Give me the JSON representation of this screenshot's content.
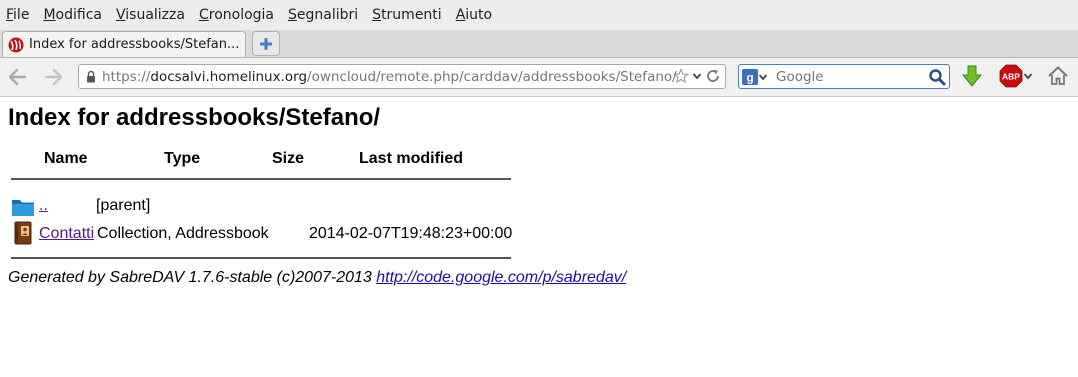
{
  "menubar": {
    "items": [
      {
        "accel": "F",
        "rest": "ile"
      },
      {
        "accel": "M",
        "rest": "odifica"
      },
      {
        "accel": "V",
        "rest": "isualizza"
      },
      {
        "accel": "C",
        "rest": "ronologia"
      },
      {
        "accel": "S",
        "rest": "egnalibri"
      },
      {
        "accel": "S",
        "rest": "trumenti"
      },
      {
        "accel": "A",
        "rest": "iuto"
      }
    ]
  },
  "tab": {
    "title": "Index for addressbooks/Stefan...",
    "favicon": "owncloud-favicon-icon"
  },
  "navbar": {
    "url_scheme": "https://",
    "url_host": "docsalvi.homelinux.org",
    "url_path": "/owncloud/remote.php/carddav/addressbooks/Stefano/",
    "search_placeholder": "Google",
    "search_engine": "google-icon",
    "icons": [
      "back-icon",
      "forward-icon",
      "lock-icon",
      "bookmark-star-icon",
      "dropdown-icon",
      "reload-icon",
      "search-icon",
      "download-arrow-icon",
      "adblock-plus-icon",
      "home-icon"
    ],
    "abp_label": "ABP"
  },
  "page": {
    "title": "Index for addressbooks/Stefano/",
    "columns": {
      "name": "Name",
      "type": "Type",
      "size": "Size",
      "last_modified": "Last modified"
    },
    "rows": [
      {
        "name": "..",
        "type": "[parent]",
        "size": "",
        "last_modified": "",
        "icon": "folder-icon"
      },
      {
        "name": "Contatti",
        "type": "Collection, Addressbook",
        "size": "",
        "last_modified": "2014-02-07T19:48:23+00:00",
        "icon": "addressbook-icon"
      }
    ],
    "footer": {
      "text": "Generated by SabreDAV 1.7.6-stable (c)2007-2013 ",
      "link": "http://code.google.com/p/sabredav/"
    }
  },
  "colors": {
    "link_visited": "#551a8b",
    "link": "#1a0dab",
    "chrome_bg": "#ececec",
    "search_border": "#4a7fc1"
  }
}
